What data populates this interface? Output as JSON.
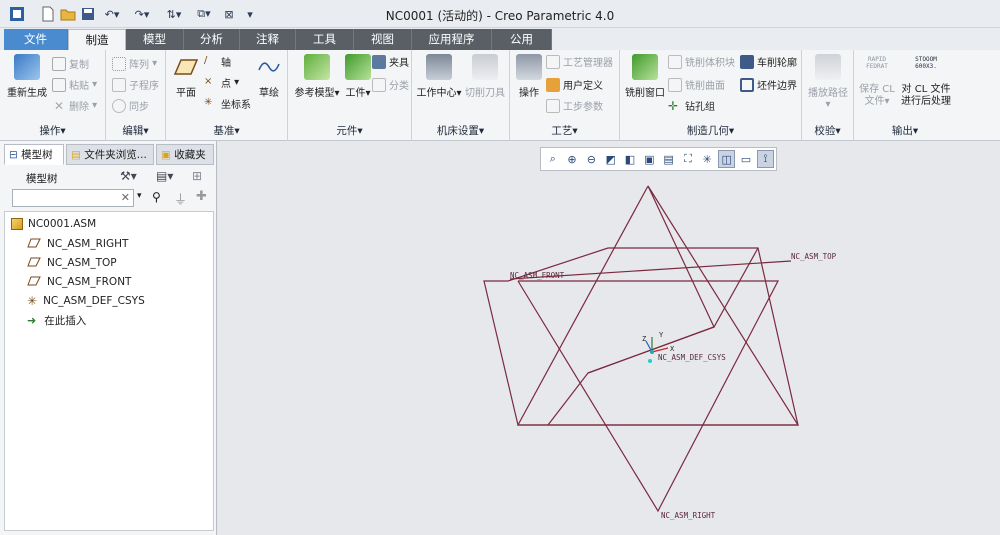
{
  "window": {
    "title": "NC0001 (活动的) - Creo Parametric 4.0"
  },
  "tabs": [
    "文件",
    "制造",
    "模型",
    "分析",
    "注释",
    "工具",
    "视图",
    "应用程序",
    "公用"
  ],
  "active_tab": "制造",
  "ribbon": {
    "operations": {
      "label": "操作",
      "regen": "重新生成",
      "copy": "复制",
      "paste": "粘贴",
      "delete": "删除"
    },
    "edit": {
      "label": "编辑",
      "pattern": "阵列",
      "subprogram": "子程序",
      "sync": "同步"
    },
    "datum": {
      "label": "基准",
      "plane": "平面",
      "axis": "轴",
      "point": "点",
      "csys": "坐标系",
      "sketch": "草绘"
    },
    "components": {
      "label": "元件",
      "ref_model": "参考模型",
      "workpiece": "工件",
      "fixture": "夹具",
      "classify": "分类"
    },
    "machine": {
      "label": "机床设置",
      "work_center": "工作中心",
      "cutting_tool": "切削刀具"
    },
    "process": {
      "label": "工艺",
      "operation": "操作",
      "process_mgr": "工艺管理器",
      "user_defined": "用户定义",
      "step_params": "工步参数"
    },
    "mfg_geometry": {
      "label": "制造几何",
      "mill_window": "铣削窗口",
      "mill_volume": "铣削体积块",
      "mill_surface": "铣削曲面",
      "drill_group": "钻孔组",
      "turn_profile": "车削轮廓",
      "stock_boundary": "坯件边界"
    },
    "validate": {
      "label": "校验",
      "play_path": "播放路径"
    },
    "output": {
      "label": "输出",
      "save_cl": "保存 CL\n文件",
      "rapid_text": "RAPID\nFEDRAT",
      "post_text": "STOOOM\n600X3.",
      "post_process": "对 CL 文件\n进行后处理"
    }
  },
  "left_panel": {
    "tabs": [
      "模型树",
      "文件夹浏览...",
      "收藏夹"
    ],
    "toolbar_label": "模型树",
    "search_placeholder": "",
    "tree": [
      {
        "name": "NC0001.ASM",
        "icon": "assembly-icon"
      },
      {
        "name": "NC_ASM_RIGHT",
        "icon": "datum-plane-icon"
      },
      {
        "name": "NC_ASM_TOP",
        "icon": "datum-plane-icon"
      },
      {
        "name": "NC_ASM_FRONT",
        "icon": "datum-plane-icon"
      },
      {
        "name": "NC_ASM_DEF_CSYS",
        "icon": "csys-icon"
      },
      {
        "name": "在此插入",
        "icon": "insert-arrow-icon"
      }
    ]
  },
  "viewport": {
    "labels": {
      "top": "NC_ASM_TOP",
      "front": "NC_ASM_FRONT",
      "right": "NC_ASM_RIGHT",
      "csys": "NC_ASM_DEF_CSYS",
      "axis_x": "X",
      "axis_y": "Y",
      "axis_z": "Z"
    }
  },
  "colors": {
    "datum_plane": "#7a2a3e",
    "tab_bar": "#5a5f66",
    "accent": "#2b5aa0"
  }
}
